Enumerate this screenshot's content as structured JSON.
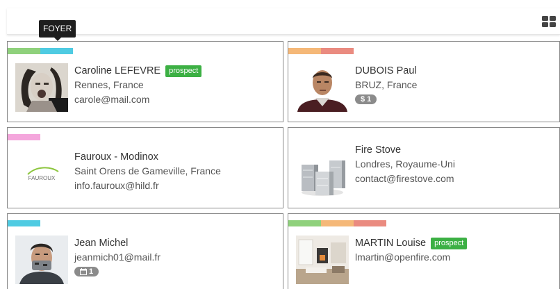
{
  "tooltip": "FOYER",
  "colors": {
    "green": "#8fd17c",
    "blue": "#4fcbe2",
    "orange": "#f5b878",
    "red": "#ea8b80",
    "pink": "#f4a6dc",
    "badge": "#3cb044",
    "pill": "#8b8b8b"
  },
  "icons": {
    "view_toggle": "grid-view-icon"
  },
  "cards": [
    {
      "name": "Caroline LEFEVRE",
      "badge": "prospect",
      "location": "Rennes, France",
      "email": "carole@mail.com",
      "tags": [
        "green",
        "blue"
      ]
    },
    {
      "name": "DUBOIS Paul",
      "location": "BRUZ, France",
      "pill": "$ 1",
      "tags": [
        "orange",
        "red"
      ]
    },
    {
      "name": "Fauroux - Modinox",
      "location": "Saint Orens de Gameville, France",
      "email": "info.fauroux@hild.fr",
      "logo_text": "FAUROUX",
      "tags": [
        "pink"
      ]
    },
    {
      "name": "Fire Stove",
      "location": "Londres, Royaume-Uni",
      "email": "contact@firestove.com",
      "tags": []
    },
    {
      "name": "Jean Michel",
      "email": "jeanmich01@mail.fr",
      "pill": "1",
      "tags": [
        "blue"
      ]
    },
    {
      "name": "MARTIN Louise",
      "badge": "prospect",
      "email": "lmartin@openfire.com",
      "tags": [
        "green",
        "orange",
        "red"
      ]
    }
  ]
}
